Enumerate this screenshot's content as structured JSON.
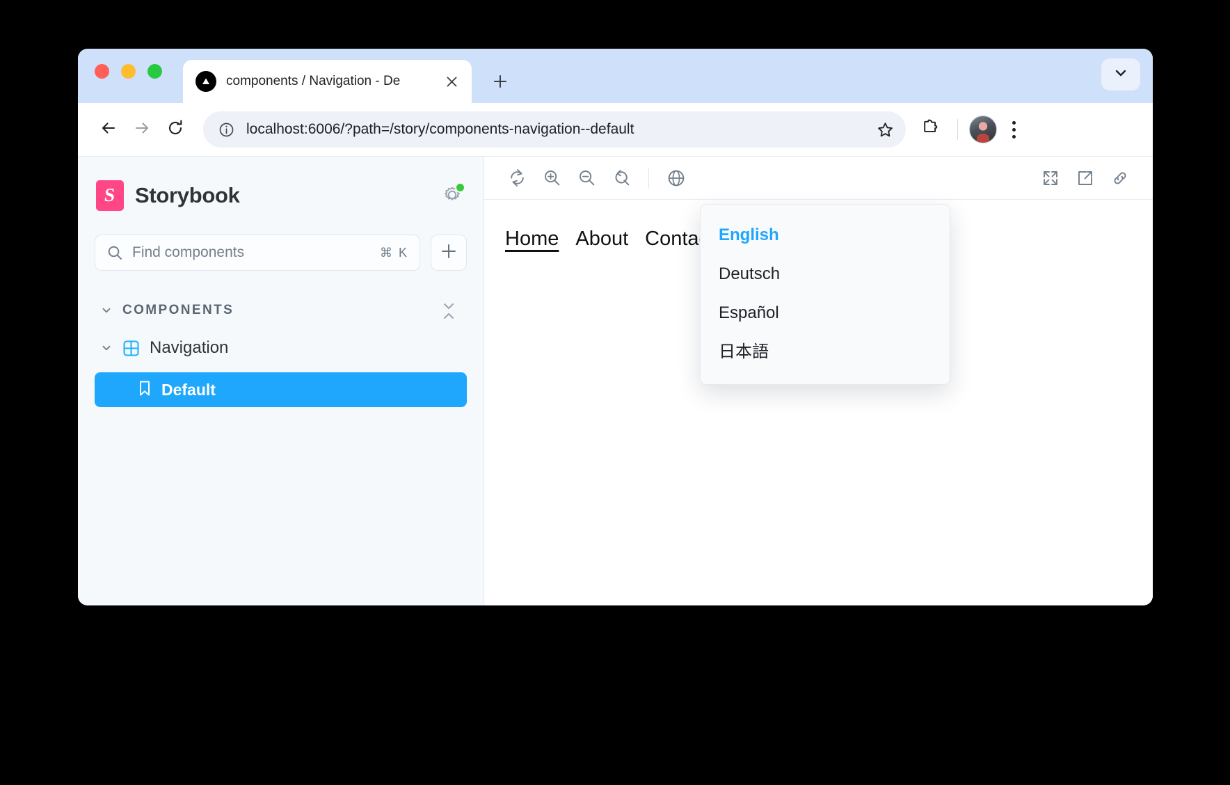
{
  "browser": {
    "tab": {
      "title": "components / Navigation - De",
      "favicon_icon": "storybook-triangle-icon",
      "close_icon": "close-icon"
    },
    "new_tab_label": "+",
    "tab_list_icon": "chevron-down-icon",
    "nav": {
      "back_icon": "arrow-left-icon",
      "forward_icon": "arrow-right-icon",
      "reload_icon": "reload-icon",
      "info_icon": "info-circle-icon",
      "url": "localhost:6006/?path=/story/components-navigation--default",
      "star_icon": "bookmark-star-icon",
      "extensions_icon": "puzzle-piece-icon",
      "avatar_icon": "profile-avatar",
      "menu_icon": "kebab-menu-icon"
    }
  },
  "sidebar": {
    "brand": "Storybook",
    "brand_mark": "S",
    "gear_icon": "gear-icon",
    "status_color": "#37c937",
    "search": {
      "placeholder": "Find components",
      "shortcut": "⌘ K",
      "icon": "search-icon"
    },
    "add_button_icon": "plus-icon",
    "group": {
      "label": "COMPONENTS",
      "expand_icon": "chevron-down-icon",
      "collapse_all_icon": "collapse-all-icon"
    },
    "component": {
      "label": "Navigation",
      "expand_icon": "chevron-down-icon",
      "type_icon": "component-grid-icon"
    },
    "story": {
      "label": "Default",
      "icon": "bookmark-icon",
      "selected_color": "#1ea7fd"
    }
  },
  "preview": {
    "toolbar": {
      "left": [
        {
          "name": "remount-icon",
          "label": "Remount component"
        },
        {
          "name": "zoom-in-icon",
          "label": "Zoom in"
        },
        {
          "name": "zoom-out-icon",
          "label": "Zoom out"
        },
        {
          "name": "zoom-reset-icon",
          "label": "Reset zoom"
        },
        {
          "name": "globe-icon",
          "label": "Locale"
        }
      ],
      "right": [
        {
          "name": "fullscreen-icon",
          "label": "Go full screen"
        },
        {
          "name": "open-new-tab-icon",
          "label": "Open canvas in new tab"
        },
        {
          "name": "copy-link-icon",
          "label": "Copy canvas link"
        }
      ]
    },
    "nav_demo": {
      "links": [
        {
          "label": "Home",
          "active": true
        },
        {
          "label": "About",
          "active": false
        },
        {
          "label": "Contact",
          "active": false
        }
      ]
    },
    "language_menu": {
      "items": [
        {
          "label": "English",
          "selected": true
        },
        {
          "label": "Deutsch",
          "selected": false
        },
        {
          "label": "Español",
          "selected": false
        },
        {
          "label": "日本語",
          "selected": false
        }
      ]
    }
  }
}
